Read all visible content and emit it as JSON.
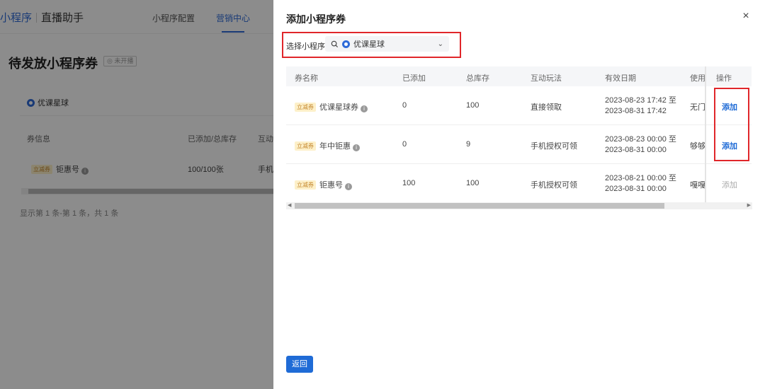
{
  "background": {
    "brand_primary": "小程序",
    "brand_secondary": "直播助手",
    "nav": [
      "小程序配置",
      "营销中心"
    ],
    "page_title": "待发放小程序券",
    "page_badge": "◎ 未开播",
    "mini_program": "优课星球",
    "table_headers": [
      "券信息",
      "已添加/总库存",
      "互动"
    ],
    "row": {
      "tag": "立减券",
      "name": "钜惠号",
      "stock": "100/100张",
      "interaction": "手机"
    },
    "footer": "显示第 1 条-第 1 条，共 1 条"
  },
  "drawer": {
    "title": "添加小程序券",
    "close": "×",
    "select_label": "选择小程序",
    "select_value": "优课星球",
    "columns": [
      "券名称",
      "已添加",
      "总库存",
      "互动玩法",
      "有效日期",
      "使用",
      "操作"
    ],
    "rows": [
      {
        "tag": "立减券",
        "name": "优课星球券",
        "added": "0",
        "stock": "100",
        "mode": "直接领取",
        "date_start": "2023-08-23 17:42 至",
        "date_end": "2023-08-31 17:42",
        "usage": "无门",
        "action": "添加",
        "enabled": true
      },
      {
        "tag": "立减券",
        "name": "年中钜惠",
        "added": "0",
        "stock": "9",
        "mode": "手机授权可领",
        "date_start": "2023-08-23 00:00 至",
        "date_end": "2023-08-31 00:00",
        "usage": "够够",
        "action": "添加",
        "enabled": true
      },
      {
        "tag": "立减券",
        "name": "钜惠号",
        "added": "100",
        "stock": "100",
        "mode": "手机授权可领",
        "date_start": "2023-08-21 00:00 至",
        "date_end": "2023-08-31 00:00",
        "usage": "嘎嘎",
        "action": "添加",
        "enabled": false
      }
    ],
    "back_button": "返回"
  },
  "colors": {
    "primary": "#1f6bd6",
    "highlight": "#e0262a",
    "tag_bg": "#fdf0c9",
    "tag_text": "#c4852a"
  }
}
